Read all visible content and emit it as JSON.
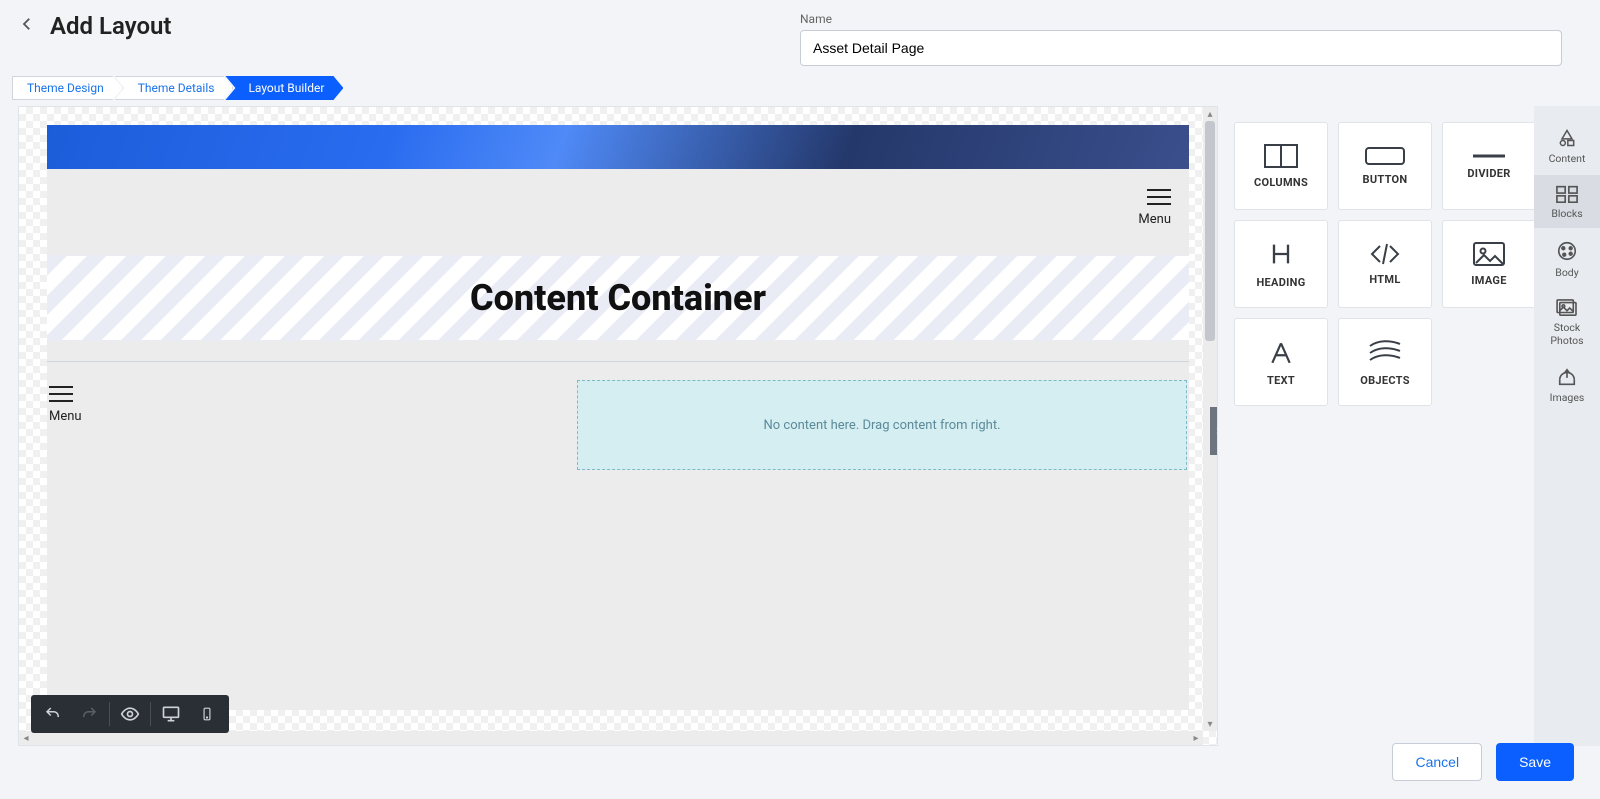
{
  "header": {
    "title": "Add Layout",
    "name_label": "Name",
    "name_value": "Asset Detail Page"
  },
  "steps": {
    "design": "Theme Design",
    "details": "Theme Details",
    "builder": "Layout Builder"
  },
  "canvas": {
    "menu_label_top": "Menu",
    "menu_label_side": "Menu",
    "content_container": "Content Container",
    "dropzone_text": "No content here. Drag content from right."
  },
  "blocks": {
    "columns": "COLUMNS",
    "button": "BUTTON",
    "divider": "DIVIDER",
    "heading": "HEADING",
    "html": "HTML",
    "image": "IMAGE",
    "text": "TEXT",
    "objects": "OBJECTS"
  },
  "side": {
    "content": "Content",
    "blocks": "Blocks",
    "body": "Body",
    "stock_photos": "Stock\nPhotos",
    "images": "Images"
  },
  "footer": {
    "cancel": "Cancel",
    "save": "Save"
  }
}
